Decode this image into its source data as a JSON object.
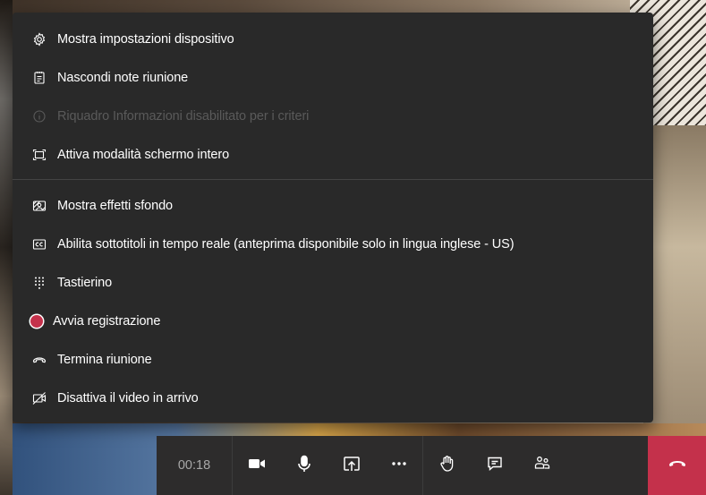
{
  "menu": {
    "items": [
      {
        "label": "Mostra impostazioni dispositivo",
        "icon": "gear-icon",
        "disabled": false
      },
      {
        "label": "Nascondi note riunione",
        "icon": "notes-icon",
        "disabled": false
      },
      {
        "label": "Riquadro Informazioni disabilitato per i criteri",
        "icon": "info-icon",
        "disabled": true
      },
      {
        "label": "Attiva modalità schermo intero",
        "icon": "fullscreen-icon",
        "disabled": false
      },
      {
        "label": "Mostra effetti sfondo",
        "icon": "background-effects-icon",
        "disabled": false
      },
      {
        "label": "Abilita sottotitoli in tempo reale (anteprima disponibile solo in lingua inglese - US)",
        "icon": "closed-captions-icon",
        "disabled": false
      },
      {
        "label": "Tastierino",
        "icon": "dialpad-icon",
        "disabled": false
      },
      {
        "label": "Avvia registrazione",
        "icon": "record-icon",
        "disabled": false
      },
      {
        "label": "Termina riunione",
        "icon": "end-call-icon",
        "disabled": false
      },
      {
        "label": "Disattiva il video in arrivo",
        "icon": "video-off-icon",
        "disabled": false
      }
    ]
  },
  "toolbar": {
    "timer": "00:18",
    "buttons": [
      "camera-icon",
      "microphone-icon",
      "share-screen-icon",
      "more-options-icon",
      "raise-hand-icon",
      "chat-icon",
      "participants-icon",
      "hang-up-icon"
    ]
  },
  "colors": {
    "menu_bg": "#292929",
    "toolbar_bg": "#2d2c2c",
    "hangup": "#c4314b",
    "record": "#c4314b",
    "disabled_text": "#5a5a5a"
  }
}
